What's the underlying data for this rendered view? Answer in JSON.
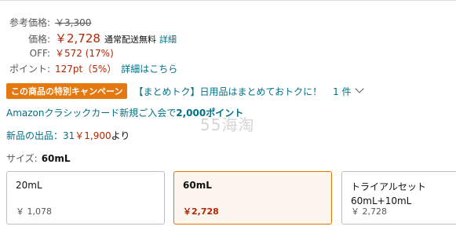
{
  "price_block": {
    "list_label": "参考価格:",
    "list_price": "￥3,300",
    "price_label": "価格:",
    "price": "￥2,728",
    "shipping": "通常配送無料",
    "details_link": "詳細",
    "off_label": "OFF:",
    "off_value": "￥572 (17%)",
    "points_label": "ポイント:",
    "points_value": "127pt（5%）",
    "points_link": "詳細はこちら"
  },
  "promo": {
    "badge": "この商品の特別キャンペーン",
    "text": "【まとめトク】日用品はまとめておトクに！",
    "count": "1 件"
  },
  "card_offer": {
    "text": "Amazonクラシックカード新規ご入会で",
    "points": "2,000ポイント"
  },
  "new_offers": {
    "label": "新品の出品：31",
    "price": "￥1,900",
    "suffix": "より"
  },
  "watermark": "55海淘",
  "size": {
    "label": "サイズ:",
    "selected": "60mL",
    "options": [
      {
        "name": "20mL",
        "sub": "",
        "price": "￥ 1,078",
        "selected": false
      },
      {
        "name": "60mL",
        "sub": "",
        "price": "￥2,728",
        "selected": true
      },
      {
        "name": "トライアルセット",
        "sub": "60mL+10mL",
        "price": "￥ 2,728",
        "selected": false
      }
    ]
  },
  "colors": {
    "accent": "#e47911",
    "price": "#b12704",
    "link": "#007185",
    "selected_border": "#e77600"
  }
}
